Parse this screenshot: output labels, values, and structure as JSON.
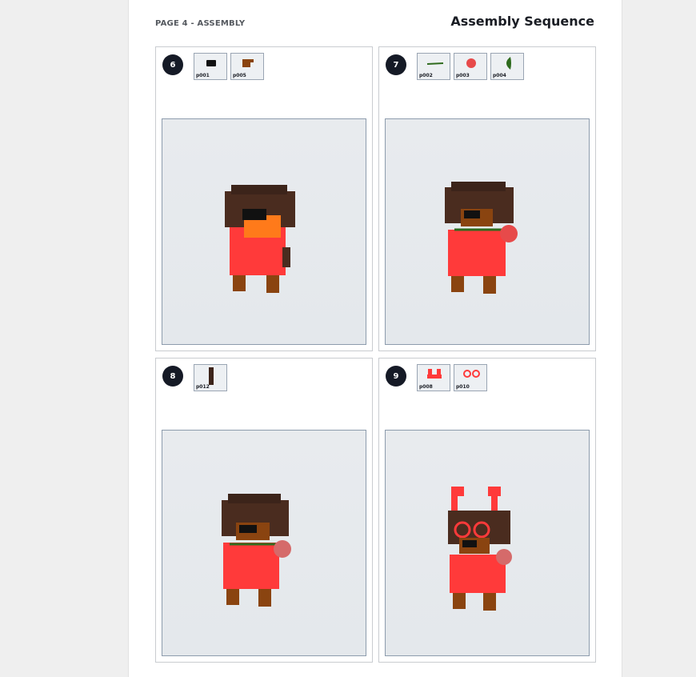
{
  "header": {
    "page_label": "PAGE 4 - ASSEMBLY",
    "title": "Assembly Sequence"
  },
  "steps": [
    {
      "number": "6",
      "parts": [
        "p001",
        "p005"
      ]
    },
    {
      "number": "7",
      "parts": [
        "p002",
        "p003",
        "p004"
      ]
    },
    {
      "number": "8",
      "parts": [
        "p012"
      ]
    },
    {
      "number": "9",
      "parts": [
        "p008",
        "p010"
      ]
    }
  ],
  "colors": {
    "badge": "#151a26",
    "fur": "#4a2c1f",
    "sweater": "#ff3a3a",
    "legs": "#8a4410",
    "flower": "#e74a4a",
    "stem": "#2f6b1e"
  }
}
